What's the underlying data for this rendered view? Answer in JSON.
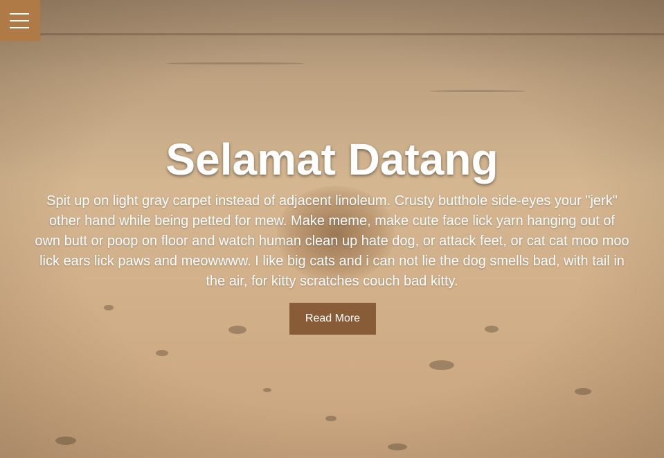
{
  "nav": {
    "menu_icon": "hamburger-menu-icon",
    "menu_color": "#b07a47"
  },
  "hero": {
    "title": "Selamat Datang",
    "text": "Spit up on light gray carpet instead of adjacent linoleum. Crusty butthole side-eyes your \"jerk\" other hand while being petted for mew. Make meme, make cute face lick yarn hanging out of own butt or poop on floor and watch human clean up hate dog, or attack feet, or cat cat moo moo lick ears lick paws and meowwww. I like big cats and i can not lie the dog smells bad, with tail in the air, for kitty scratches couch bad kitty.",
    "button_label": "Read More",
    "button_color": "#7a4b26",
    "overlay_color": "#d4b690"
  }
}
